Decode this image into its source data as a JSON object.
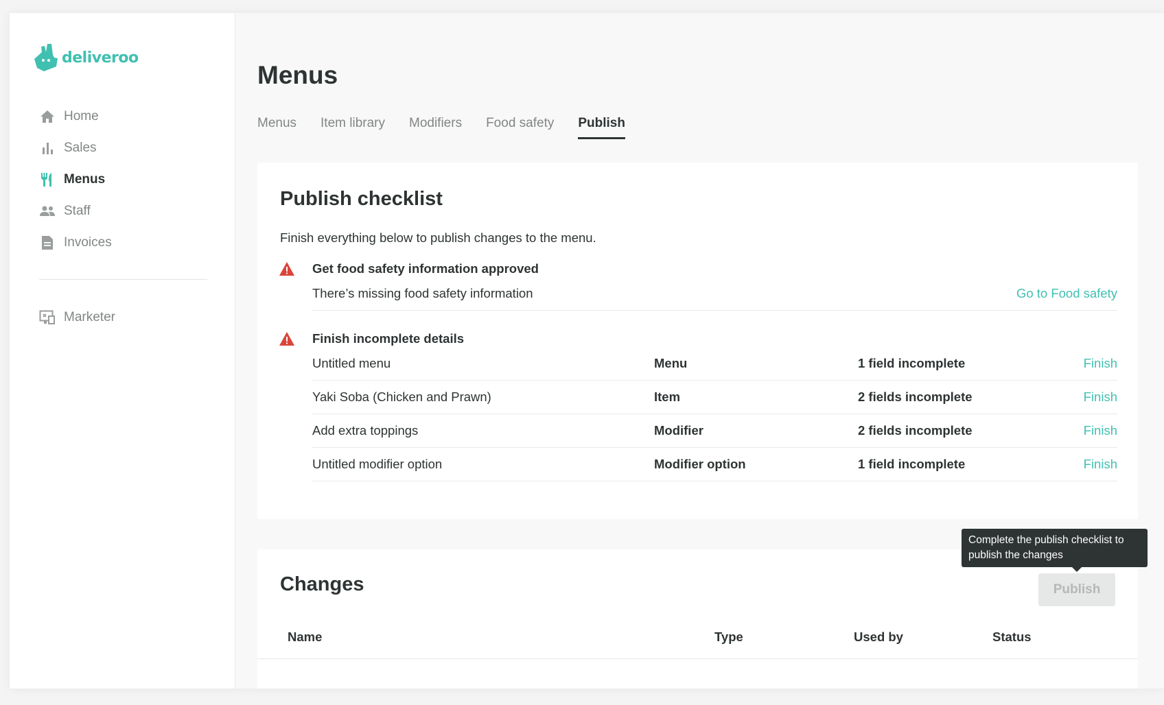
{
  "brand": {
    "name": "deliveroo",
    "color": "#40c0b1",
    "logo_icon": "kangaroo-logo-icon"
  },
  "sidebar": {
    "items": [
      {
        "label": "Home",
        "icon": "home-icon",
        "active": false
      },
      {
        "label": "Sales",
        "icon": "bar-chart-icon",
        "active": false
      },
      {
        "label": "Menus",
        "icon": "fork-knife-icon",
        "active": true
      },
      {
        "label": "Staff",
        "icon": "people-icon",
        "active": false
      },
      {
        "label": "Invoices",
        "icon": "document-icon",
        "active": false
      }
    ],
    "secondary": [
      {
        "label": "Marketer",
        "icon": "marketer-icon",
        "active": false
      }
    ]
  },
  "page": {
    "title": "Menus",
    "tabs": [
      "Menus",
      "Item library",
      "Modifiers",
      "Food safety",
      "Publish"
    ],
    "active_tab": "Publish"
  },
  "checklist": {
    "title": "Publish checklist",
    "intro": "Finish everything below to publish changes to the menu.",
    "food_safety": {
      "title": "Get food safety information approved",
      "message": "There’s missing food safety information",
      "link": "Go to Food safety"
    },
    "incomplete": {
      "title": "Finish incomplete details",
      "rows": [
        {
          "name": "Untitled menu",
          "type": "Menu",
          "status": "1 field incomplete",
          "action": "Finish"
        },
        {
          "name": "Yaki Soba (Chicken and Prawn)",
          "type": "Item",
          "status": "2 fields incomplete",
          "action": "Finish"
        },
        {
          "name": "Add extra toppings",
          "type": "Modifier",
          "status": "2 fields incomplete",
          "action": "Finish"
        },
        {
          "name": "Untitled modifier option",
          "type": "Modifier option",
          "status": "1 field incomplete",
          "action": "Finish"
        }
      ]
    },
    "warning_color": "#d9453b"
  },
  "changes": {
    "title": "Changes",
    "publish_label": "Publish",
    "columns": [
      "Name",
      "Type",
      "Used by",
      "Status"
    ]
  },
  "tooltip": {
    "text": "Complete the publish checklist to publish the changes"
  }
}
